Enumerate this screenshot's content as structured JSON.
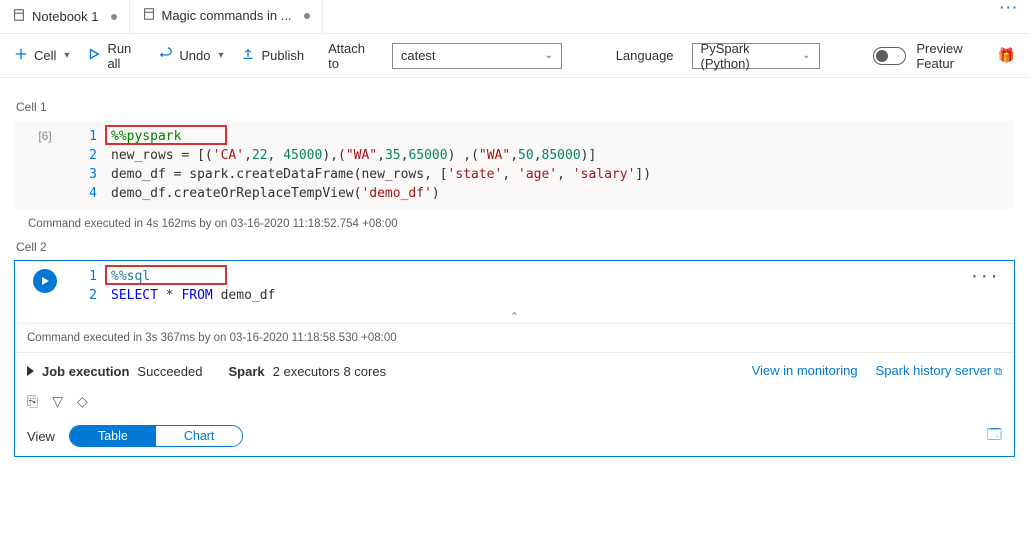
{
  "tabs": {
    "t1": "Notebook 1",
    "t2": "Magic commands in ..."
  },
  "toolbar": {
    "cell": "Cell",
    "runall": "Run all",
    "undo": "Undo",
    "publish": "Publish",
    "attach_label": "Attach to",
    "attach_value": "catest",
    "lang_label": "Language",
    "lang_value": "PySpark (Python)",
    "preview": "Preview Featur"
  },
  "cell1": {
    "label": "Cell 1",
    "exec": "[6]",
    "status": "Command executed in 4s 162ms by        on 03-16-2020 11:18:52.754 +08:00",
    "ln1": "1",
    "ln2": "2",
    "ln3": "3",
    "ln4": "4"
  },
  "cell2": {
    "label": "Cell 2",
    "status": "Command executed in 3s 367ms by        on 03-16-2020 11:18:58.530 +08:00",
    "ln1": "1",
    "ln2": "2",
    "code2_select": "SELECT",
    "code2_star": " * ",
    "code2_from": "FROM",
    "code2_tbl": " demo_df",
    "magic": "%%sql"
  },
  "code1": {
    "magic": "%%pyspark",
    "l2a": "new_rows = [(",
    "l2b": "'CA'",
    "l2c": ",",
    "l2d": "22",
    "l2e": ", ",
    "l2f": "45000",
    "l2g": "),(",
    "l2h": "\"WA\"",
    "l2i": ",",
    "l2j": "35",
    "l2k": ",",
    "l2l": "65000",
    "l2m": ") ,(",
    "l2n": "\"WA\"",
    "l2o": ",",
    "l2p": "50",
    "l2q": ",",
    "l2r": "85000",
    "l2s": ")]",
    "l3a": "demo_df = spark.createDataFrame(new_rows, [",
    "l3b": "'state'",
    "l3c": ", ",
    "l3d": "'age'",
    "l3e": ", ",
    "l3f": "'salary'",
    "l3g": "])",
    "l4a": "demo_df.createOrReplaceTempView(",
    "l4b": "'demo_df'",
    "l4c": ")"
  },
  "job": {
    "label": "Job execution",
    "status": "Succeeded",
    "spark_lbl": "Spark",
    "spark_val": "2 executors 8 cores",
    "monitoring": "View in monitoring",
    "history": "Spark history server"
  },
  "view": {
    "label": "View",
    "table": "Table",
    "chart": "Chart"
  }
}
